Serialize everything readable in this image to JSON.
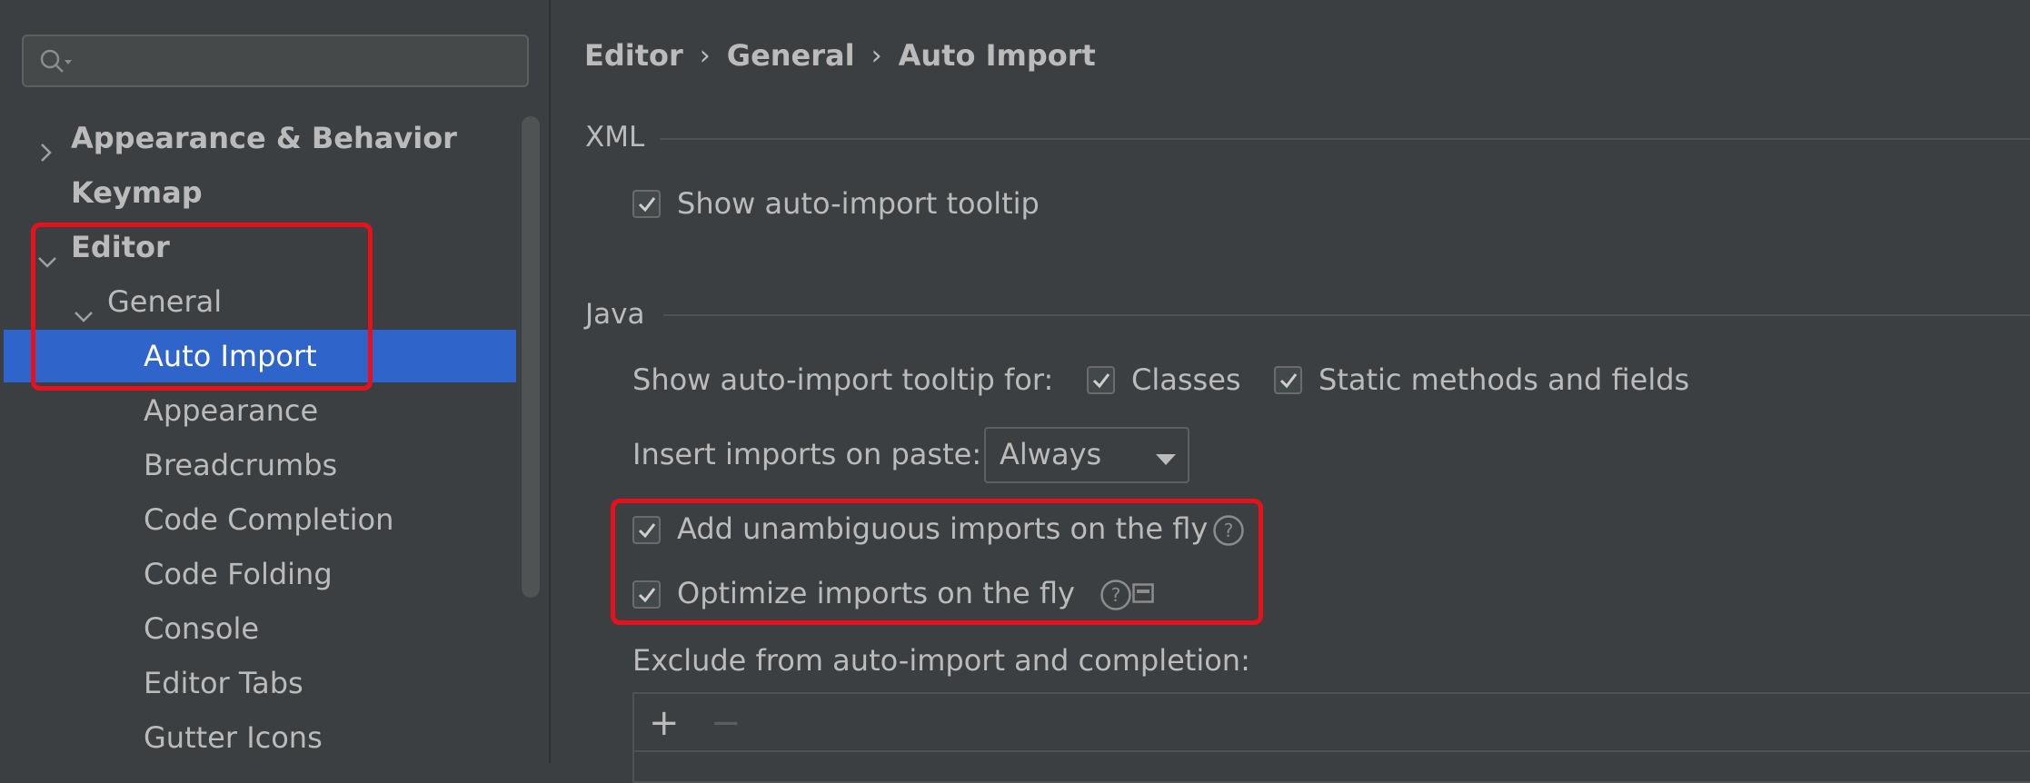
{
  "search": {
    "placeholder": ""
  },
  "sidebar": {
    "items": [
      {
        "label": "Appearance & Behavior"
      },
      {
        "label": "Keymap"
      },
      {
        "label": "Editor"
      },
      {
        "label": "General"
      },
      {
        "label": "Auto Import"
      },
      {
        "label": "Appearance"
      },
      {
        "label": "Breadcrumbs"
      },
      {
        "label": "Code Completion"
      },
      {
        "label": "Code Folding"
      },
      {
        "label": "Console"
      },
      {
        "label": "Editor Tabs"
      },
      {
        "label": "Gutter Icons"
      }
    ]
  },
  "breadcrumb": {
    "items": [
      "Editor",
      "General",
      "Auto Import"
    ],
    "separator": "›"
  },
  "xml": {
    "title": "XML",
    "show_tooltip": {
      "label": "Show auto-import tooltip",
      "checked": true
    }
  },
  "java": {
    "title": "Java",
    "tooltip_for_label": "Show auto-import tooltip for:",
    "classes": {
      "label": "Classes",
      "checked": true
    },
    "static_methods": {
      "label": "Static methods and fields",
      "checked": true
    },
    "insert_on_paste_label": "Insert imports on paste:",
    "insert_on_paste_value": "Always",
    "add_unambiguous": {
      "label": "Add unambiguous imports on the fly",
      "checked": true
    },
    "optimize_imports": {
      "label": "Optimize imports on the fly",
      "checked": true
    },
    "exclude_label": "Exclude from auto-import and completion:",
    "add_button": "+",
    "remove_button": "−"
  },
  "colors": {
    "background": "#3c3f41",
    "selection": "#2f65ca",
    "highlight": "#e8111b",
    "text": "#bbbbbb"
  }
}
